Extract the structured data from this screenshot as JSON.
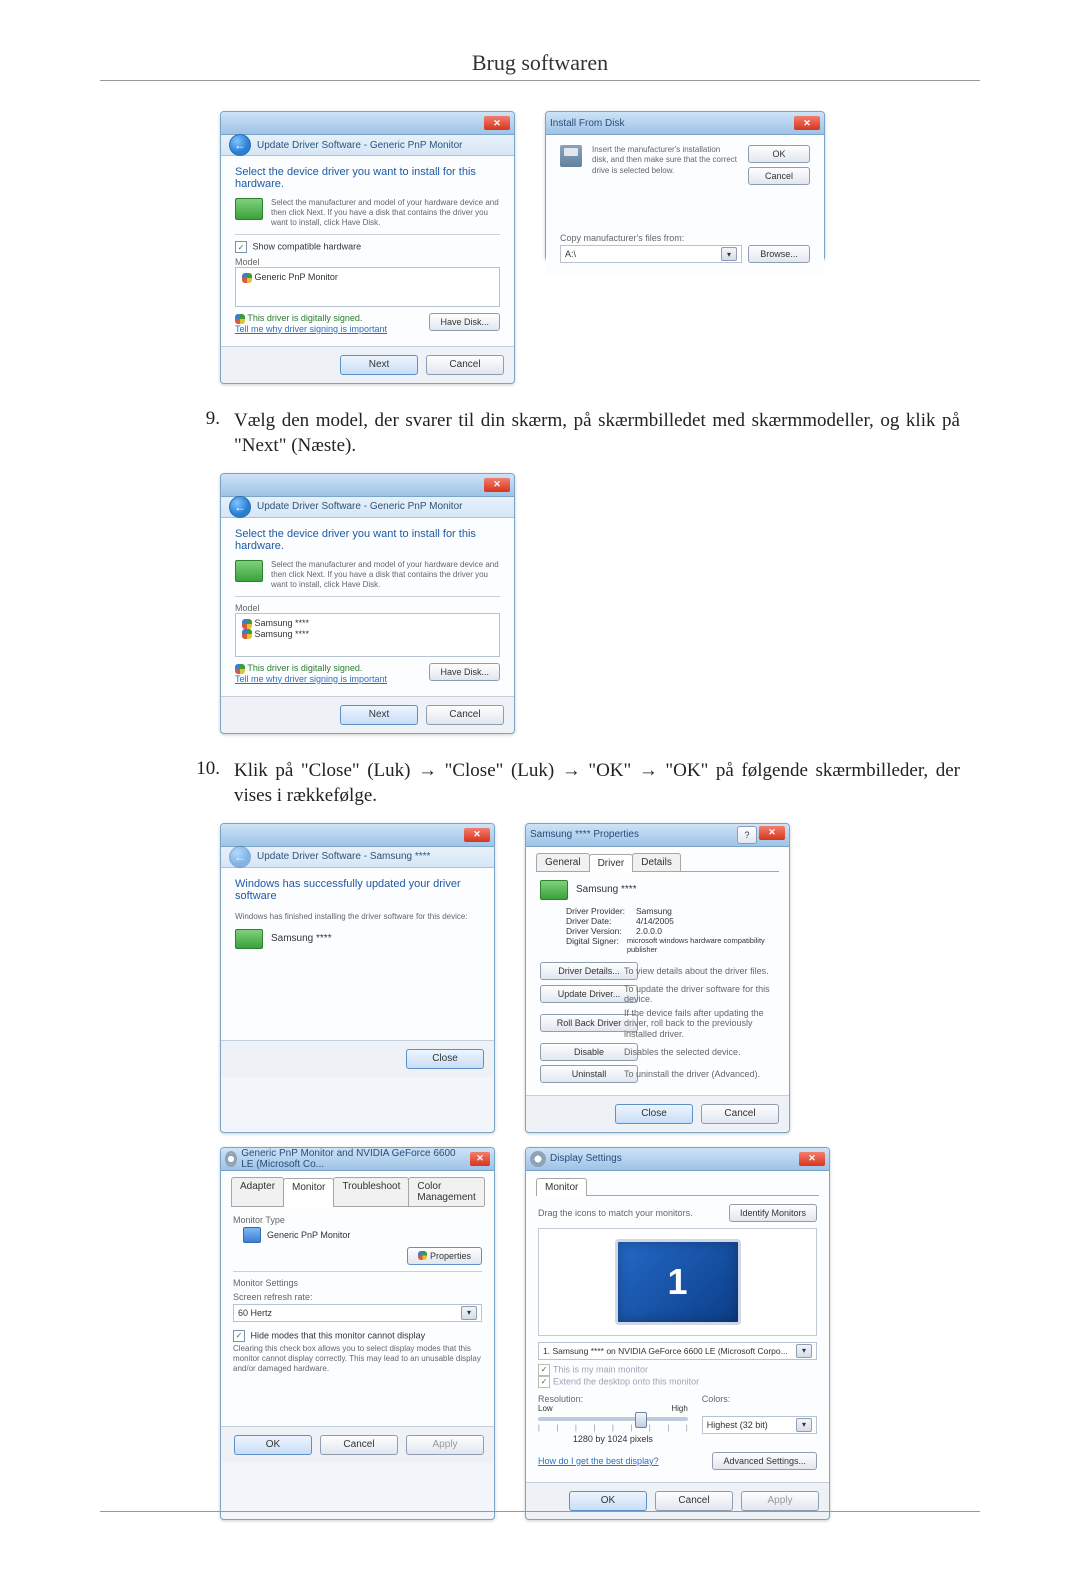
{
  "header": {
    "title": "Brug softwaren"
  },
  "steps": {
    "s9": {
      "num": "9.",
      "text": "Vælg den model, der svarer til din skærm, på skærmbilledet med skærmmodeller, og klik på \"Next\" (Næste)."
    },
    "s10": {
      "num": "10.",
      "text": "Klik på \"Close\" (Luk) → \"Close\" (Luk) → \"OK\" → \"OK\" på følgende skærmbilleder, der vises i rækkefølge."
    }
  },
  "dlg1": {
    "path": "Update Driver Software - Generic PnP Monitor",
    "heading": "Select the device driver you want to install for this hardware.",
    "note": "Select the manufacturer and model of your hardware device and then click Next. If you have a disk that contains the driver you want to install, click Have Disk.",
    "compatCheck": "Show compatible hardware",
    "modelLabel": "Model",
    "modelItem": "Generic PnP Monitor",
    "signed": "This driver is digitally signed.",
    "signedLink": "Tell me why driver signing is important",
    "haveDisk": "Have Disk...",
    "next": "Next",
    "cancel": "Cancel"
  },
  "dlg2": {
    "title": "Install From Disk",
    "text": "Insert the manufacturer's installation disk, and then make sure that the correct drive is selected below.",
    "ok": "OK",
    "cancel": "Cancel",
    "copyLabel": "Copy manufacturer's files from:",
    "copyValue": "A:\\",
    "browse": "Browse..."
  },
  "dlg3": {
    "path": "Update Driver Software - Generic PnP Monitor",
    "heading": "Select the device driver you want to install for this hardware.",
    "note": "Select the manufacturer and model of your hardware device and then click Next. If you have a disk that contains the driver you want to install, click Have Disk.",
    "modelLabel": "Model",
    "modelItem1": "Samsung ****",
    "modelItem2": "Samsung ****",
    "signed": "This driver is digitally signed.",
    "signedLink": "Tell me why driver signing is important",
    "haveDisk": "Have Disk...",
    "next": "Next",
    "cancel": "Cancel"
  },
  "dlg4": {
    "path": "Update Driver Software - Samsung ****",
    "heading": "Windows has successfully updated your driver software",
    "sub": "Windows has finished installing the driver software for this device:",
    "device": "Samsung ****",
    "close": "Close"
  },
  "dlg5": {
    "title": "Samsung **** Properties",
    "tabs": {
      "general": "General",
      "driver": "Driver",
      "details": "Details"
    },
    "device": "Samsung ****",
    "rows": {
      "providerL": "Driver Provider:",
      "providerV": "Samsung",
      "dateL": "Driver Date:",
      "dateV": "4/14/2005",
      "versionL": "Driver Version:",
      "versionV": "2.0.0.0",
      "signerL": "Digital Signer:",
      "signerV": "microsoft windows hardware compatibility publisher"
    },
    "btns": {
      "details": "Driver Details...",
      "detailsD": "To view details about the driver files.",
      "update": "Update Driver...",
      "updateD": "To update the driver software for this device.",
      "rollback": "Roll Back Driver",
      "rollbackD": "If the device fails after updating the driver, roll back to the previously installed driver.",
      "disable": "Disable",
      "disableD": "Disables the selected device.",
      "uninstall": "Uninstall",
      "uninstallD": "To uninstall the driver (Advanced)."
    },
    "close": "Close",
    "cancel": "Cancel"
  },
  "dlg6": {
    "title": "Generic PnP Monitor and NVIDIA GeForce 6600 LE (Microsoft Co...",
    "tabs": {
      "adapter": "Adapter",
      "monitor": "Monitor",
      "trouble": "Troubleshoot",
      "color": "Color Management"
    },
    "typeLabel": "Monitor Type",
    "typeValue": "Generic PnP Monitor",
    "properties": "Properties",
    "settingsLabel": "Monitor Settings",
    "refreshLabel": "Screen refresh rate:",
    "refreshValue": "60 Hertz",
    "hideCheck": "Hide modes that this monitor cannot display",
    "hideText": "Clearing this check box allows you to select display modes that this monitor cannot display correctly. This may lead to an unusable display and/or damaged hardware.",
    "ok": "OK",
    "cancel": "Cancel",
    "apply": "Apply"
  },
  "dlg7": {
    "title": "Display Settings",
    "tab": "Monitor",
    "dragText": "Drag the icons to match your monitors.",
    "identify": "Identify Monitors",
    "monNum": "1",
    "displaySel": "1. Samsung **** on NVIDIA GeForce 6600 LE (Microsoft Corpo...",
    "chkMain": "This is my main monitor",
    "chkExtend": "Extend the desktop onto this monitor",
    "resolutionL": "Resolution:",
    "colorsL": "Colors:",
    "low": "Low",
    "high": "High",
    "resVal": "1280 by 1024 pixels",
    "colorsVal": "Highest (32 bit)",
    "bestLink": "How do I get the best display?",
    "advanced": "Advanced Settings...",
    "ok": "OK",
    "cancel": "Cancel",
    "apply": "Apply"
  }
}
